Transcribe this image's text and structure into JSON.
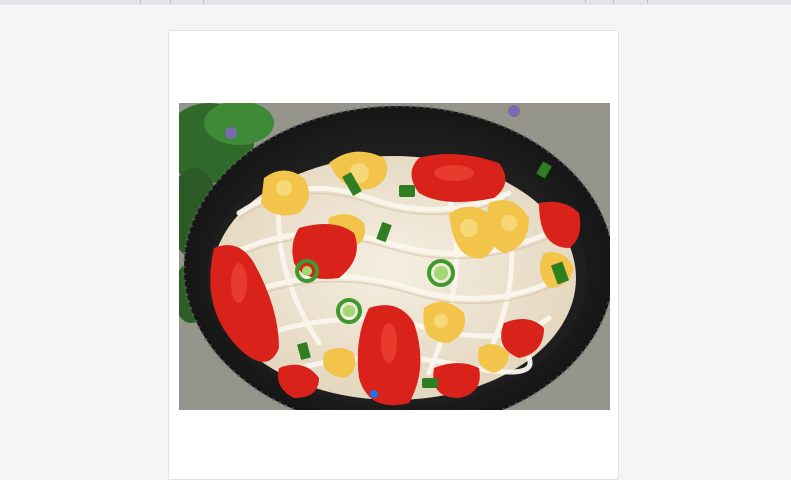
{
  "photo": {
    "alt": "",
    "indicator_color": "#1a73e8"
  }
}
